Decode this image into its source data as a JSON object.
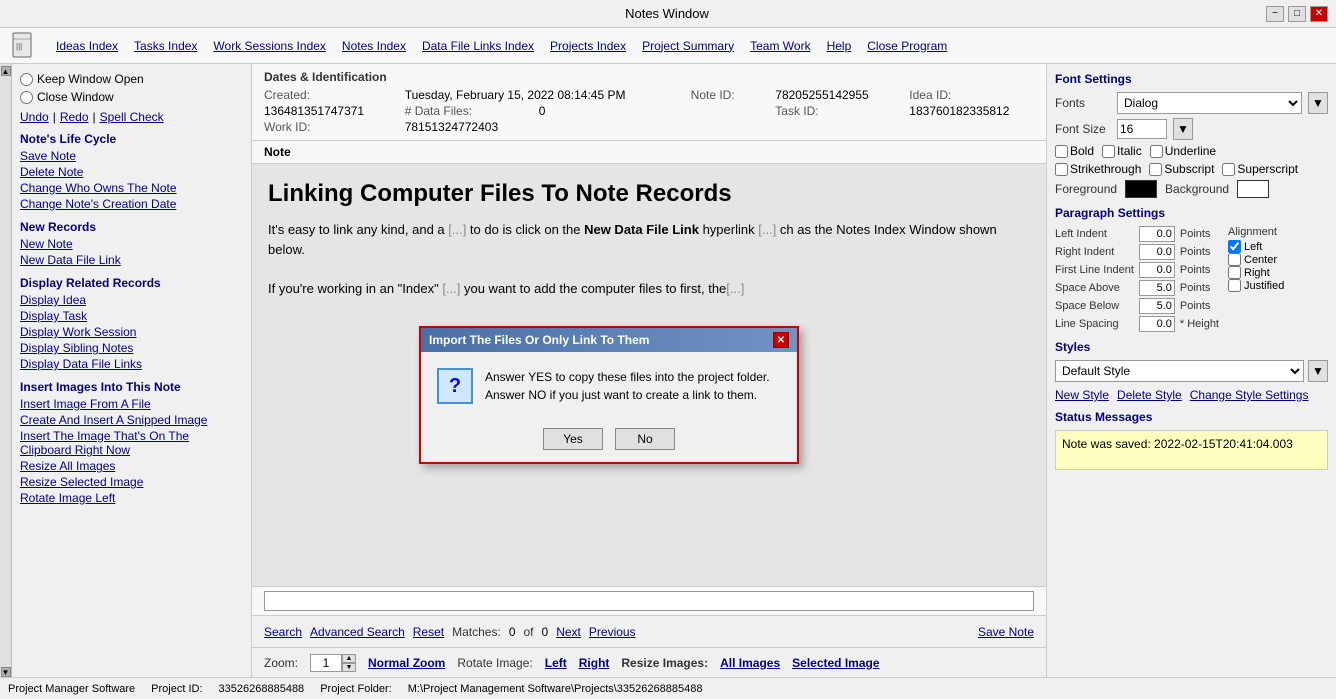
{
  "titleBar": {
    "title": "Notes Window",
    "minimizeLabel": "−",
    "maximizeLabel": "□",
    "closeLabel": "✕"
  },
  "menuBar": {
    "appIconLabel": "📄",
    "items": [
      {
        "label": "Ideas Index"
      },
      {
        "label": "Tasks Index"
      },
      {
        "label": "Work Sessions Index"
      },
      {
        "label": "Notes Index"
      },
      {
        "label": "Data File Links Index"
      },
      {
        "label": "Projects Index"
      },
      {
        "label": "Project Summary"
      },
      {
        "label": "Team Work"
      },
      {
        "label": "Help"
      },
      {
        "label": "Close Program"
      }
    ]
  },
  "sidebar": {
    "keepWindowOpen": "Keep Window Open",
    "closeWindow": "Close Window",
    "undo": "Undo",
    "redo": "Redo",
    "spellCheck": "Spell Check",
    "sections": [
      {
        "title": "Note's Life Cycle",
        "items": [
          "Save Note",
          "Delete Note",
          "Change Who Owns The Note",
          "Change Note's Creation Date"
        ]
      },
      {
        "title": "New Records",
        "items": [
          "New Note",
          "New Data File Link"
        ]
      },
      {
        "title": "Display Related Records",
        "items": [
          "Display Idea",
          "Display Task",
          "Display Work Session",
          "Display Sibling Notes",
          "Display Data File Links"
        ]
      },
      {
        "title": "Insert Images Into This Note",
        "items": [
          "Insert Image From A File",
          "Create And Insert A Snipped Image",
          "Insert The Image That's On The Clipboard Right Now",
          "Resize All Images",
          "Resize Selected Image",
          "Rotate Image Left"
        ]
      }
    ]
  },
  "dates": {
    "sectionTitle": "Dates & Identification",
    "createdLabel": "Created:",
    "createdValue": "Tuesday, February 15, 2022   08:14:45 PM",
    "dataFilesLabel": "# Data Files:",
    "dataFilesValue": "0",
    "noteIdLabel": "Note ID:",
    "noteIdValue": "78205255142955",
    "ideaIdLabel": "Idea ID:",
    "ideaIdValue": "136481351747371",
    "taskIdLabel": "Task ID:",
    "taskIdValue": "183760182335812",
    "workIdLabel": "Work ID:",
    "workIdValue": "78151324772403"
  },
  "note": {
    "sectionTitle": "Note",
    "title": "Linking Computer Files To Note Records",
    "body1": "It's easy to link any kind, and a",
    "body1cont": "to do is click on the",
    "body2strong": "New Data File Link",
    "body2": "hyperlink",
    "body2cont": "ch as the Notes Index Window shown below.",
    "body3": "If you're working in an \"Index\"",
    "body3cont": "you want to add the computer files to first, the"
  },
  "searchBar": {
    "searchLabel": "Search",
    "advancedSearchLabel": "Advanced Search",
    "resetLabel": "Reset",
    "matchesLabel": "Matches:",
    "matchesValue": "0",
    "ofLabel": "of",
    "ofValue": "0",
    "nextLabel": "Next",
    "previousLabel": "Previous",
    "saveNoteLabel": "Save Note"
  },
  "zoomBar": {
    "zoomLabel": "Zoom:",
    "zoomValue": "1",
    "normalZoomLabel": "Normal Zoom",
    "rotateImageLabel": "Rotate Image:",
    "rotateLeftLabel": "Left",
    "rotateRightLabel": "Right",
    "resizeImagesLabel": "Resize Images:",
    "allImagesLabel": "All Images",
    "selectedImageLabel": "Selected Image"
  },
  "rightPanel": {
    "fontSettings": {
      "title": "Font Settings",
      "fontsLabel": "Fonts",
      "fontsValue": "Dialog",
      "fontSizeLabel": "Font Size",
      "fontSizeValue": "16",
      "bold": "Bold",
      "italic": "Italic",
      "underline": "Underline",
      "strikethrough": "Strikethrough",
      "subscript": "Subscript",
      "superscript": "Superscript",
      "foregroundLabel": "Foreground",
      "backgroundLabel": "Background"
    },
    "paragraphSettings": {
      "title": "Paragraph Settings",
      "leftIndentLabel": "Left Indent",
      "leftIndentValue": "0.0",
      "rightIndentLabel": "Right Indent",
      "rightIndentValue": "0.0",
      "firstLineIndentLabel": "First Line Indent",
      "firstLineIndentValue": "0.0",
      "spaceAboveLabel": "Space Above",
      "spaceAboveValue": "5.0",
      "spaceBelowLabel": "Space Below",
      "spaceBelowValue": "5.0",
      "lineSpacingLabel": "Line Spacing",
      "lineSpacingValue": "0.0",
      "pointsLabel": "Points",
      "heightLabel": "* Height",
      "alignmentLabel": "Alignment",
      "leftLabel": "Left",
      "centerLabel": "Center",
      "rightLabel": "Right",
      "justifiedLabel": "Justified"
    },
    "styles": {
      "title": "Styles",
      "defaultStyle": "Default Style",
      "newStyleLabel": "New Style",
      "deleteStyleLabel": "Delete Style",
      "changeStyleSettingsLabel": "Change Style Settings"
    },
    "statusMessages": {
      "title": "Status Messages",
      "message": "Note was saved:  2022-02-15T20:41:04.003"
    }
  },
  "dialog": {
    "title": "Import The Files Or Only Link To Them",
    "iconLabel": "?",
    "text1": "Answer YES to copy these files into the project folder.",
    "text2": "Answer NO if you just want to create a link to them.",
    "yesLabel": "Yes",
    "noLabel": "No"
  },
  "statusBar": {
    "softwareName": "Project Manager Software",
    "projectIdLabel": "Project ID:",
    "projectIdValue": "33526268885488",
    "projectFolderLabel": "Project Folder:",
    "projectFolderValue": "M:\\Project Management Software\\Projects\\33526268885488"
  }
}
